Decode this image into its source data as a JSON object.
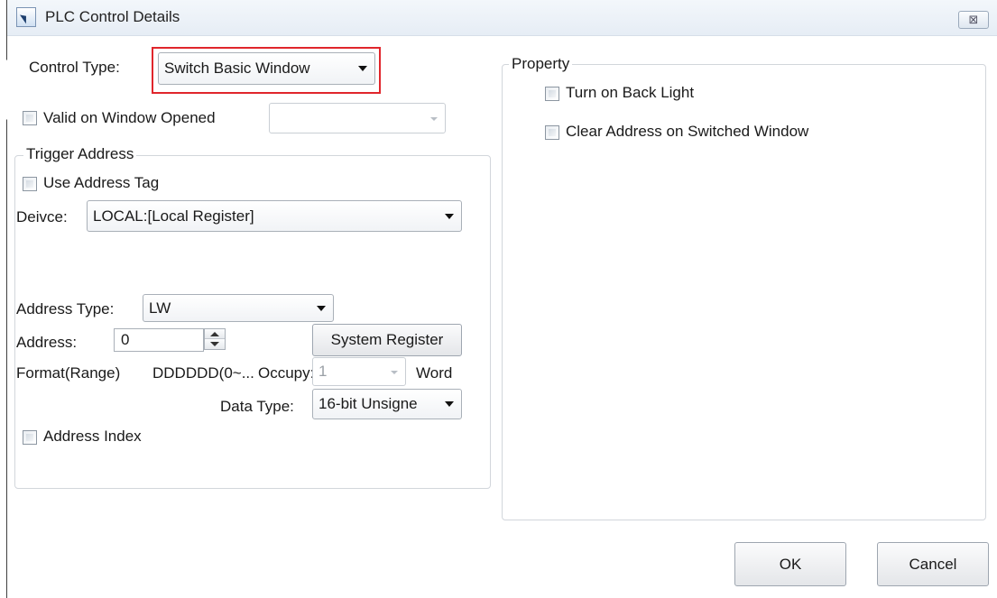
{
  "window": {
    "title": "PLC Control Details",
    "close_glyph": "⊠"
  },
  "control_type": {
    "label": "Control Type:",
    "value": "Switch Basic Window"
  },
  "valid_on_window_opened": {
    "label": "Valid on Window Opened",
    "checked": false,
    "value": ""
  },
  "trigger_address": {
    "title": "Trigger Address",
    "use_address_tag": {
      "label": "Use Address Tag",
      "checked": false
    },
    "device": {
      "label": "Deivce:",
      "value": "LOCAL:[Local Register]"
    },
    "address_type": {
      "label": "Address Type:",
      "value": "LW"
    },
    "address": {
      "label": "Address:",
      "value": "0"
    },
    "system_register_button": "System Register",
    "format": {
      "label": "Format(Range)",
      "value": "DDDDDD(0~...",
      "occupy_label": "Occupy:",
      "occupy_value": "1",
      "unit": "Word"
    },
    "data_type": {
      "label": "Data Type:",
      "value": "16-bit Unsigne"
    },
    "address_index": {
      "label": "Address Index",
      "checked": false
    }
  },
  "property": {
    "title": "Property",
    "turn_on_back_light": {
      "label": "Turn on Back Light",
      "checked": false
    },
    "clear_address": {
      "label": "Clear Address on Switched Window",
      "checked": false
    }
  },
  "buttons": {
    "ok": "OK",
    "cancel": "Cancel"
  },
  "colors": {
    "highlight": "#e0262c",
    "title_bar": "#e6edf5"
  }
}
